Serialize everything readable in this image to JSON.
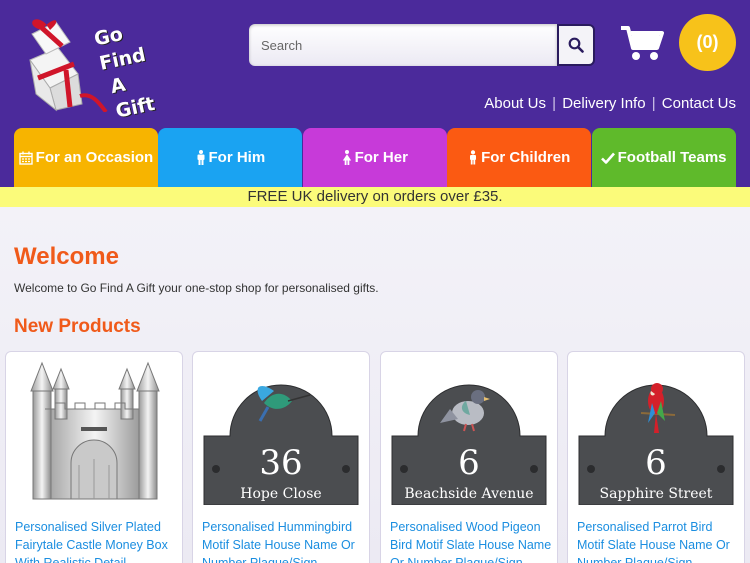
{
  "logo": {
    "line1": "Go Find",
    "line2": "A Gift"
  },
  "search": {
    "placeholder": "Search"
  },
  "cart": {
    "count_label": "(0)"
  },
  "toplinks": [
    {
      "label": "About Us"
    },
    {
      "label": "Delivery Info"
    },
    {
      "label": "Contact Us"
    }
  ],
  "nav": [
    {
      "label": "For an Occasion",
      "icon": "calendar-icon",
      "color": "#f7b400"
    },
    {
      "label": "For Him",
      "icon": "male-icon",
      "color": "#1aa3f2"
    },
    {
      "label": "For Her",
      "icon": "female-icon",
      "color": "#c73ad9"
    },
    {
      "label": "For Children",
      "icon": "child-icon",
      "color": "#fb5a12"
    },
    {
      "label": "Football Teams",
      "icon": "check-icon",
      "color": "#5fba2b"
    }
  ],
  "promo": "FREE UK delivery on orders over £35.",
  "main": {
    "welcome_heading": "Welcome",
    "welcome_text": "Welcome to Go Find A Gift your one-stop shop for personalised gifts.",
    "new_products_heading": "New Products"
  },
  "products": [
    {
      "title": "Personalised Silver Plated Fairytale Castle Money Box With Realistic Detail"
    },
    {
      "title": "Personalised Hummingbird Motif Slate House Name Or Number Plaque/Sign -",
      "plaque_number": "36",
      "plaque_name": "Hope Close"
    },
    {
      "title": "Personalised Wood Pigeon Bird Motif Slate House Name Or Number Plaque/Sign -",
      "plaque_number": "6",
      "plaque_name": "Beachside Avenue"
    },
    {
      "title": "Personalised Parrot Bird Motif Slate House Name Or Number Plaque/Sign -",
      "plaque_number": "6",
      "plaque_name": "Sapphire Street"
    }
  ],
  "colors": {
    "header_bg": "#4b2a9b",
    "accent_orange": "#f05a1a",
    "link_blue": "#1b8ee0",
    "promo_bg": "#fbfb7a",
    "cart_badge": "#f7c21a"
  }
}
